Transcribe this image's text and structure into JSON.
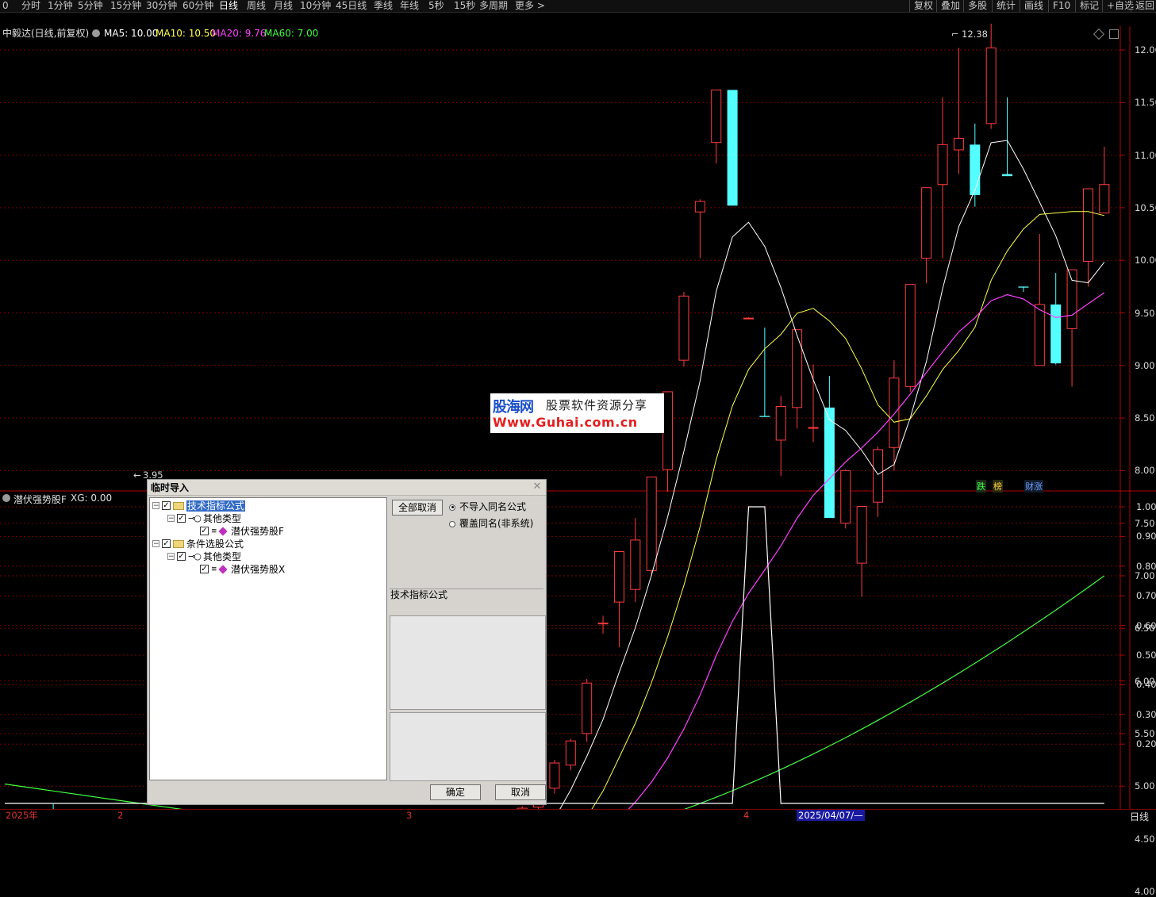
{
  "toolbar": {
    "left_icon": "0",
    "periods": [
      "分时",
      "1分钟",
      "5分钟",
      "15分钟",
      "30分钟",
      "60分钟",
      "日线",
      "周线",
      "月线",
      "10分钟",
      "45日线",
      "季线",
      "年线",
      "5秒",
      "15秒",
      "多周期",
      "更多 >"
    ],
    "active_period": "日线",
    "right": [
      "复权",
      "叠加",
      "多股",
      "统计",
      "画线",
      "F10",
      "标记",
      "+自选",
      "返回"
    ]
  },
  "stock": {
    "title": "中毅达(日线,前复权)",
    "ma5": "MA5: 10.00",
    "ma10": "MA10: 10.50",
    "ma20": "MA20: 9.76",
    "ma60": "MA60: 7.00",
    "high_mark": "12.38",
    "low_mark": "3.95"
  },
  "colors": {
    "up": "#ff3c3c",
    "down": "#54ffff",
    "ma5": "#ffffff",
    "ma10": "#ffff4a",
    "ma20": "#ff40ff",
    "ma60": "#40ff40",
    "grid": "#7a0000"
  },
  "price_axis": [
    "12.00",
    "11.50",
    "11.00",
    "10.50",
    "10.00",
    "9.50",
    "9.00",
    "8.50",
    "8.00",
    "7.50",
    "7.00",
    "6.50",
    "6.00",
    "5.50",
    "5.00",
    "4.50",
    "4.00"
  ],
  "tags": {
    "die": "跌",
    "bang": "榜",
    "caizhang": "财涨"
  },
  "indicator": {
    "name": "潜伏强势股F",
    "value": "XG: 0.00",
    "axis": [
      "1.00",
      "0.90",
      "0.80",
      "0.70",
      "0.60",
      "0.50",
      "0.40",
      "0.30",
      "0.20"
    ]
  },
  "watermark": {
    "brand": "股海网",
    "slogan": "股票软件资源分享",
    "url": "Www.Guhai.com.cn"
  },
  "dialog": {
    "title": "临时导入",
    "tree": [
      {
        "label": "技术指标公式"
      },
      {
        "label": "其他类型"
      },
      {
        "label": "潜伏强势股F"
      },
      {
        "label": "条件选股公式"
      },
      {
        "label": "其他类型"
      },
      {
        "label": "潜伏强势股X"
      }
    ],
    "cancel_all": "全部取消",
    "radio1": "不导入同名公式",
    "radio2": "覆盖同名(非系统)",
    "section_label": "技术指标公式",
    "ok": "确定",
    "cancel": "取消"
  },
  "bottom": {
    "year": "2025年",
    "m2": "2",
    "m3": "3",
    "m4": "4",
    "cursor_date": "2025/04/07/—",
    "period_label": "日线"
  }
}
